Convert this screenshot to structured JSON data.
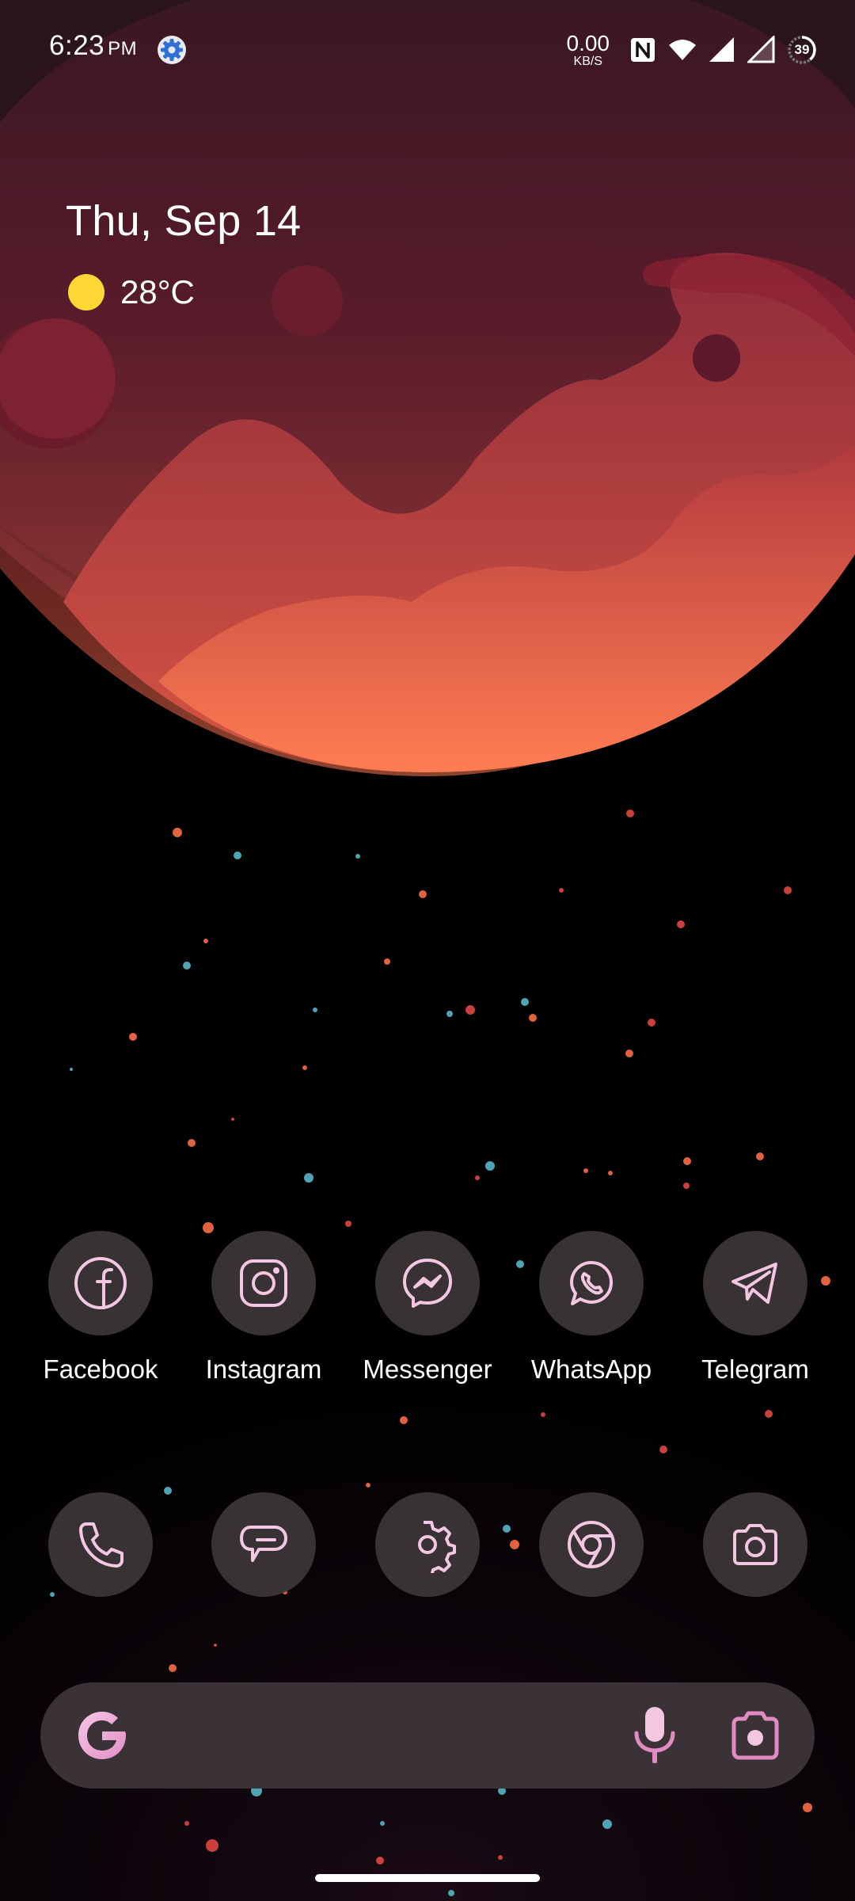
{
  "status_bar": {
    "time": "6:23",
    "ampm": "PM",
    "net_speed_value": "0.00",
    "net_speed_unit": "KB/S",
    "battery_level": "39",
    "icons": [
      "settings-icon",
      "nfc-icon",
      "wifi-icon",
      "signal-icon",
      "signal-icon",
      "battery-icon"
    ]
  },
  "widget": {
    "date": "Thu, Sep 14",
    "temperature": "28°C",
    "weather_icon": "sun-icon"
  },
  "apps_row1": [
    {
      "label": "Facebook",
      "icon": "facebook-icon"
    },
    {
      "label": "Instagram",
      "icon": "instagram-icon"
    },
    {
      "label": "Messenger",
      "icon": "messenger-icon"
    },
    {
      "label": "WhatsApp",
      "icon": "whatsapp-icon"
    },
    {
      "label": "Telegram",
      "icon": "telegram-icon"
    }
  ],
  "apps_dock": [
    {
      "icon": "phone-icon"
    },
    {
      "icon": "messages-icon"
    },
    {
      "icon": "settings-icon"
    },
    {
      "icon": "chrome-icon"
    },
    {
      "icon": "camera-icon"
    }
  ],
  "search_bar": {
    "icons": [
      "google-g-icon",
      "microphone-icon",
      "google-lens-icon"
    ]
  },
  "colors": {
    "icon_tint": "#f3c6e2",
    "icon_bg": "#3e363a",
    "planet_light": "#ff7a52",
    "planet_dark": "#5a1a2c",
    "sun": "#fdd835"
  }
}
